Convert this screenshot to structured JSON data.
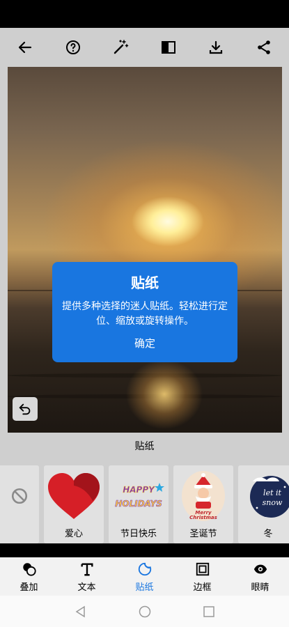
{
  "toolbar": {
    "back_icon": "arrow-left-icon",
    "help_icon": "question-circle-icon",
    "magic_icon": "magic-wand-icon",
    "compare_icon": "compare-split-icon",
    "download_icon": "download-icon",
    "share_icon": "share-icon"
  },
  "dialog": {
    "title": "贴纸",
    "body": "提供多种选择的迷人贴纸。轻松进行定位、缩放或旋转操作。",
    "confirm": "确定"
  },
  "section": {
    "title": "贴纸"
  },
  "stickers": [
    {
      "label": "",
      "icon": "no-sticker-icon"
    },
    {
      "label": "爱心",
      "icon": "heart-sticker"
    },
    {
      "label": "节日快乐",
      "icon": "happy-holidays-sticker",
      "art_text": "HAPPY HOLIDAYS"
    },
    {
      "label": "圣诞节",
      "icon": "santa-sticker",
      "art_text": "Merry Christmas"
    },
    {
      "label": "冬",
      "icon": "let-it-snow-sticker",
      "art_text": "let it snow"
    }
  ],
  "bottom_nav": [
    {
      "label": "叠加",
      "icon": "overlay-icon"
    },
    {
      "label": "文本",
      "icon": "text-icon"
    },
    {
      "label": "贴纸",
      "icon": "sticker-icon",
      "active": true
    },
    {
      "label": "边框",
      "icon": "frame-icon"
    },
    {
      "label": "眼睛",
      "icon": "eye-icon"
    }
  ],
  "colors": {
    "accent": "#1976e0",
    "toolbar_bg": "#cfcfcf",
    "tile_bg": "#e1e1e1"
  }
}
